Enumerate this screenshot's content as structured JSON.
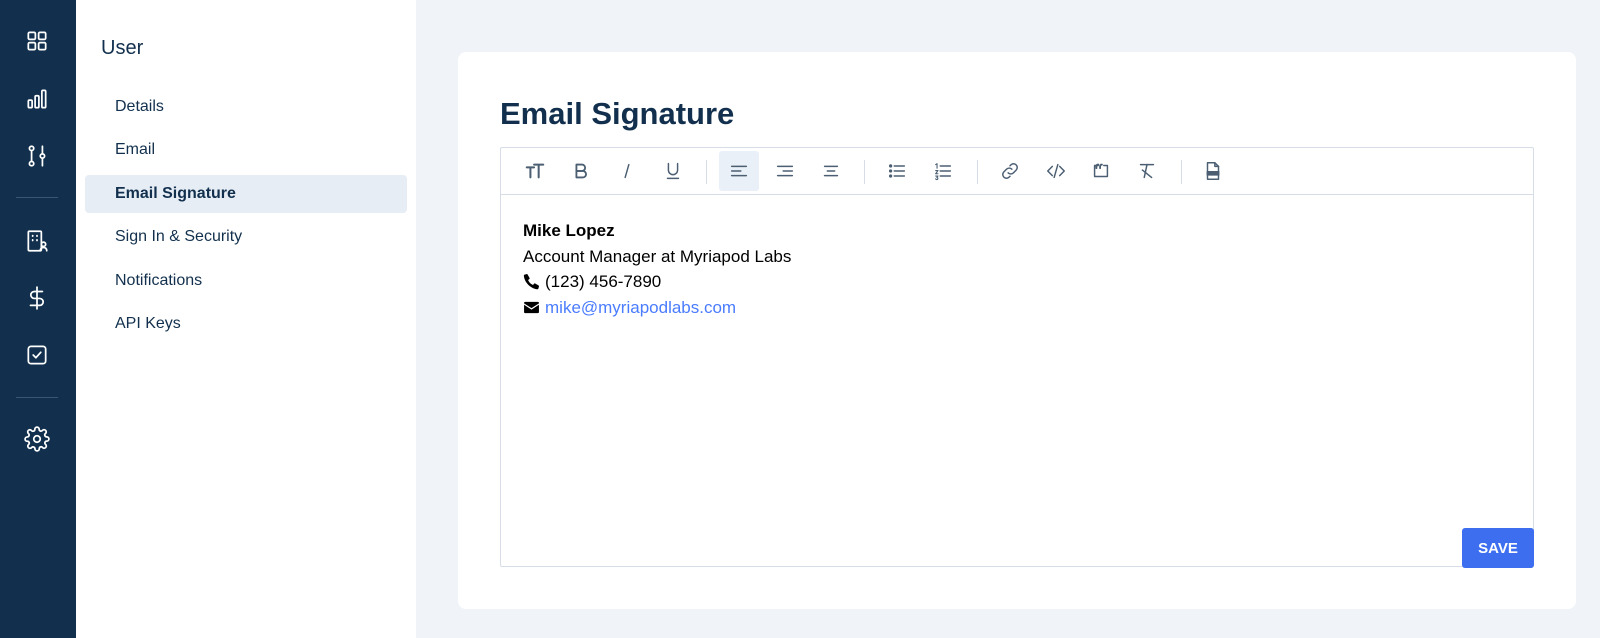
{
  "rail": {
    "icons": [
      "dashboard-grid-icon",
      "bar-chart-icon",
      "pipeline-icon",
      "building-icon",
      "dollar-icon",
      "checkbox-icon",
      "gear-icon"
    ]
  },
  "subnav": {
    "title": "User",
    "items": [
      {
        "label": "Details"
      },
      {
        "label": "Email"
      },
      {
        "label": "Email Signature",
        "active": true
      },
      {
        "label": "Sign In & Security"
      },
      {
        "label": "Notifications"
      },
      {
        "label": "API Keys"
      }
    ]
  },
  "main": {
    "title": "Email Signature",
    "signature": {
      "name": "Mike Lopez",
      "role": "Account Manager at Myriapod Labs",
      "phone": "(123) 456-7890",
      "email": "mike@myriapodlabs.com"
    },
    "save_label": "SAVE"
  },
  "colors": {
    "rail": "#12304d",
    "accent": "#3d6ef0",
    "link": "#4a7cff",
    "background": "#f0f3f8"
  }
}
